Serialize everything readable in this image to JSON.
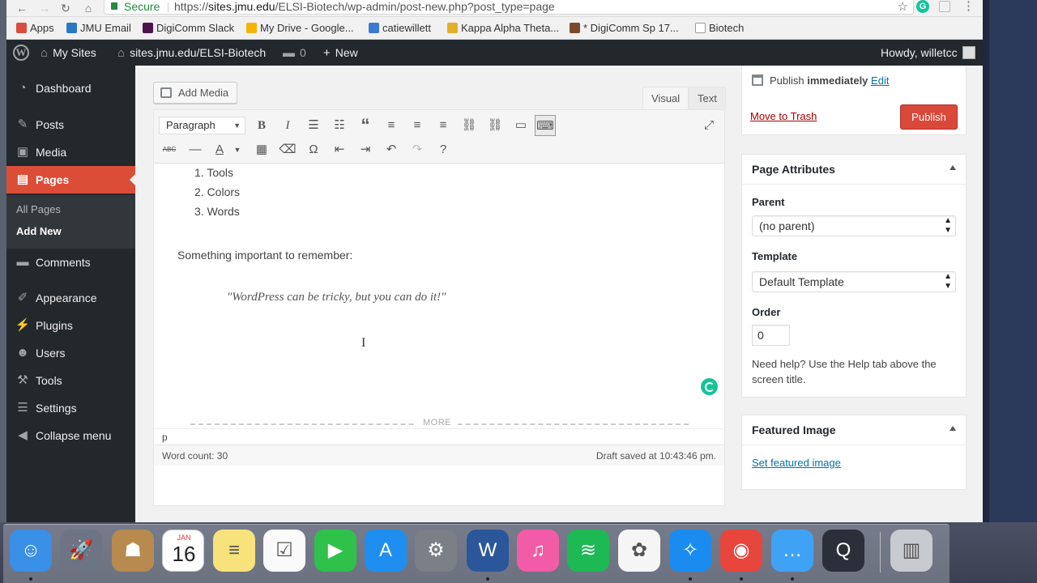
{
  "browser": {
    "secure_label": "Secure",
    "url_scheme": "https://",
    "url_host": "sites.jmu.edu",
    "url_path": "/ELSI-Biotech/wp-admin/post-new.php?post_type=page",
    "grammarly_label": "G"
  },
  "bookmarks": [
    {
      "label": "Apps",
      "icon": "apps-grid-icon",
      "color": "#d94d3f"
    },
    {
      "label": "JMU Email",
      "icon": "email-icon",
      "color": "#2b78c5"
    },
    {
      "label": "DigiComm Slack",
      "icon": "slack-icon",
      "color": "#4a154b"
    },
    {
      "label": "My Drive - Google...",
      "icon": "google-drive-icon",
      "color": "#f4b400"
    },
    {
      "label": "catiewillett",
      "icon": "wix-icon",
      "color": "#3b7bd4"
    },
    {
      "label": "Kappa Alpha Theta...",
      "icon": "kite-icon",
      "color": "#e0b02b"
    },
    {
      "label": "* DigiComm Sp 17...",
      "icon": "canvas-icon",
      "color": "#7a4b2a"
    },
    {
      "label": "Biotech",
      "icon": "page-icon",
      "color": "#cccccc"
    }
  ],
  "adminbar": {
    "my_sites": "My Sites",
    "site": "sites.jmu.edu/ELSI-Biotech",
    "comments_count": "0",
    "new_label": "New",
    "howdy": "Howdy, willetcc"
  },
  "sidebar": {
    "items": [
      {
        "label": "Dashboard",
        "icon": "dashboard-icon",
        "glyph": "◔"
      },
      {
        "label": "Posts",
        "icon": "pin-icon",
        "glyph": "✎"
      },
      {
        "label": "Media",
        "icon": "media-icon",
        "glyph": "▣"
      },
      {
        "label": "Pages",
        "icon": "pages-icon",
        "glyph": "▤"
      },
      {
        "label": "Comments",
        "icon": "comment-icon",
        "glyph": "▬"
      },
      {
        "label": "Appearance",
        "icon": "brush-icon",
        "glyph": "✐"
      },
      {
        "label": "Plugins",
        "icon": "plug-icon",
        "glyph": "⚡"
      },
      {
        "label": "Users",
        "icon": "users-icon",
        "glyph": "☻"
      },
      {
        "label": "Tools",
        "icon": "wrench-icon",
        "glyph": "⚒"
      },
      {
        "label": "Settings",
        "icon": "settings-icon",
        "glyph": "☰"
      },
      {
        "label": "Collapse menu",
        "icon": "collapse-icon",
        "glyph": "◀"
      }
    ],
    "submenu": [
      "All Pages",
      "Add New"
    ]
  },
  "editor": {
    "add_media": "Add Media",
    "tab_visual": "Visual",
    "tab_text": "Text",
    "format_select": "Paragraph",
    "list_items": [
      "1. Tools",
      "2. Colors",
      "3. Words"
    ],
    "paragraph": "Something important to remember:",
    "quote": "\"WordPress can be tricky, but you can do it!\"",
    "more_label": "MORE",
    "path": "p",
    "word_count": "Word count: 30",
    "draft_saved": "Draft saved at 10:43:46 pm."
  },
  "publish": {
    "publish_prefix": "Publish",
    "publish_when": "immediately",
    "edit_link": "Edit",
    "trash_link": "Move to Trash",
    "publish_button": "Publish"
  },
  "page_attributes": {
    "title": "Page Attributes",
    "parent_label": "Parent",
    "parent_value": "(no parent)",
    "template_label": "Template",
    "template_value": "Default Template",
    "order_label": "Order",
    "order_value": "0",
    "help": "Need help? Use the Help tab above the screen title."
  },
  "featured_image": {
    "title": "Featured Image",
    "link": "Set featured image"
  },
  "dock": {
    "calendar_month": "JAN",
    "calendar_day": "16",
    "apps": [
      {
        "name": "finder-icon",
        "color": "#3a8fe6"
      },
      {
        "name": "launchpad-icon",
        "color": "#6d7585"
      },
      {
        "name": "contacts-icon",
        "color": "#b88a4e"
      },
      {
        "name": "calendar-icon",
        "color": "#ffffff"
      },
      {
        "name": "notes-icon",
        "color": "#f7e27b"
      },
      {
        "name": "reminders-icon",
        "color": "#fafafa"
      },
      {
        "name": "facetime-icon",
        "color": "#2fc14a"
      },
      {
        "name": "app-store-icon",
        "color": "#1e8ff0"
      },
      {
        "name": "system-preferences-icon",
        "color": "#7b7f86"
      },
      {
        "name": "word-icon",
        "color": "#2b579a"
      },
      {
        "name": "itunes-icon",
        "color": "#f25ba7"
      },
      {
        "name": "spotify-icon",
        "color": "#1db954"
      },
      {
        "name": "photos-icon",
        "color": "#f5f5f5"
      },
      {
        "name": "safari-icon",
        "color": "#1a8cf0"
      },
      {
        "name": "chrome-icon",
        "color": "#e8453c"
      },
      {
        "name": "messages-icon",
        "color": "#3fa3f5"
      },
      {
        "name": "quicktime-icon",
        "color": "#2a2f3a"
      },
      {
        "name": "trash-icon",
        "color": "#c7cacf"
      }
    ]
  }
}
